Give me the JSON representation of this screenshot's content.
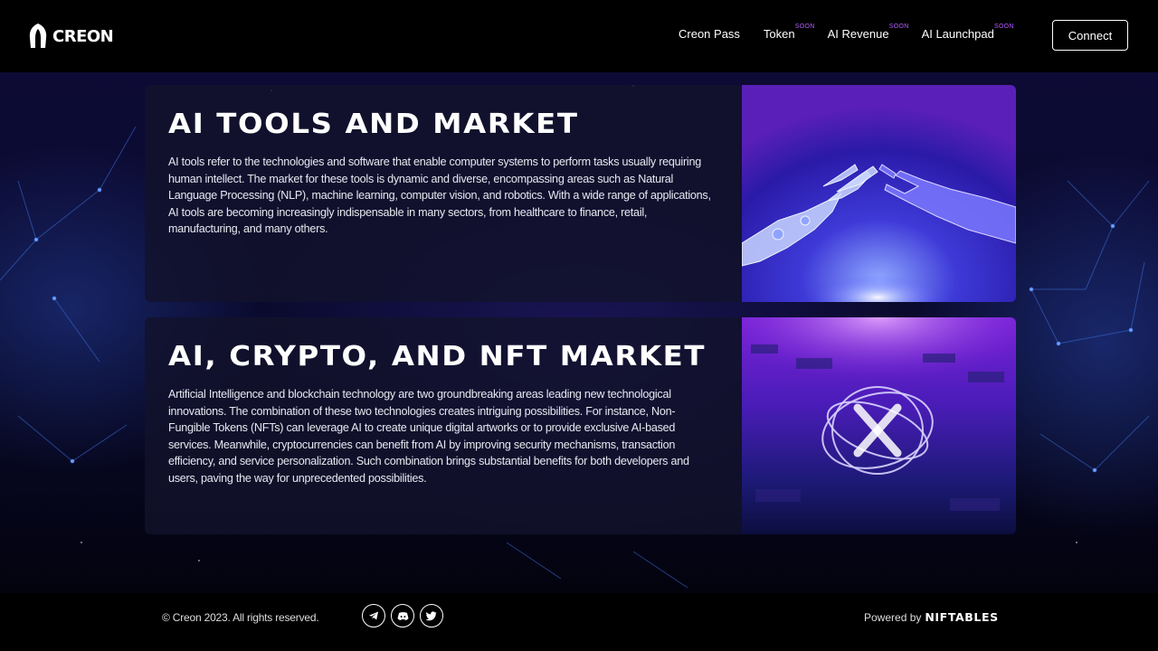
{
  "header": {
    "logo_text": "CREON",
    "nav": [
      {
        "label": "Creon Pass",
        "badge": ""
      },
      {
        "label": "Token",
        "badge": "SOON"
      },
      {
        "label": "AI Revenue",
        "badge": "SOON"
      },
      {
        "label": "AI Launchpad",
        "badge": "SOON"
      }
    ],
    "connect_label": "Connect"
  },
  "sections": [
    {
      "title": "AI TOOLS AND MARKET",
      "body": "AI tools refer to the technologies and software that enable computer systems to perform tasks usually requiring human intellect. The market for these tools is dynamic and diverse, encompassing areas such as Natural Language Processing (NLP), machine learning, computer vision, and robotics. With a wide range of applications, AI tools are becoming increasingly indispensable in many sectors, from healthcare to finance, retail, manufacturing, and many others.",
      "image": "robot-and-human-hand-touching"
    },
    {
      "title": "AI, CRYPTO, AND NFT MARKET",
      "body": "Artificial Intelligence and blockchain technology are two groundbreaking areas leading new technological innovations. The combination of these two technologies creates intriguing possibilities. For instance, Non-Fungible Tokens (NFTs) can leverage AI to create unique digital artworks or to provide exclusive AI-based services. Meanwhile, cryptocurrencies can benefit from AI by improving security mechanisms, transaction efficiency, and service personalization. Such combination brings substantial benefits for both developers and users, paving the way for unprecedented possibilities.",
      "image": "holographic-crypto-rings"
    }
  ],
  "footer": {
    "copyright": "© Creon 2023. All rights reserved.",
    "socials": [
      "telegram-icon",
      "discord-icon",
      "twitter-icon"
    ],
    "powered_by": "Powered by",
    "powered_brand": "NIFTABLES"
  },
  "colors": {
    "badge": "#b45cff",
    "card_bg": "#12122c",
    "accent_purple": "#7a2cff",
    "header_bg": "#000000"
  }
}
